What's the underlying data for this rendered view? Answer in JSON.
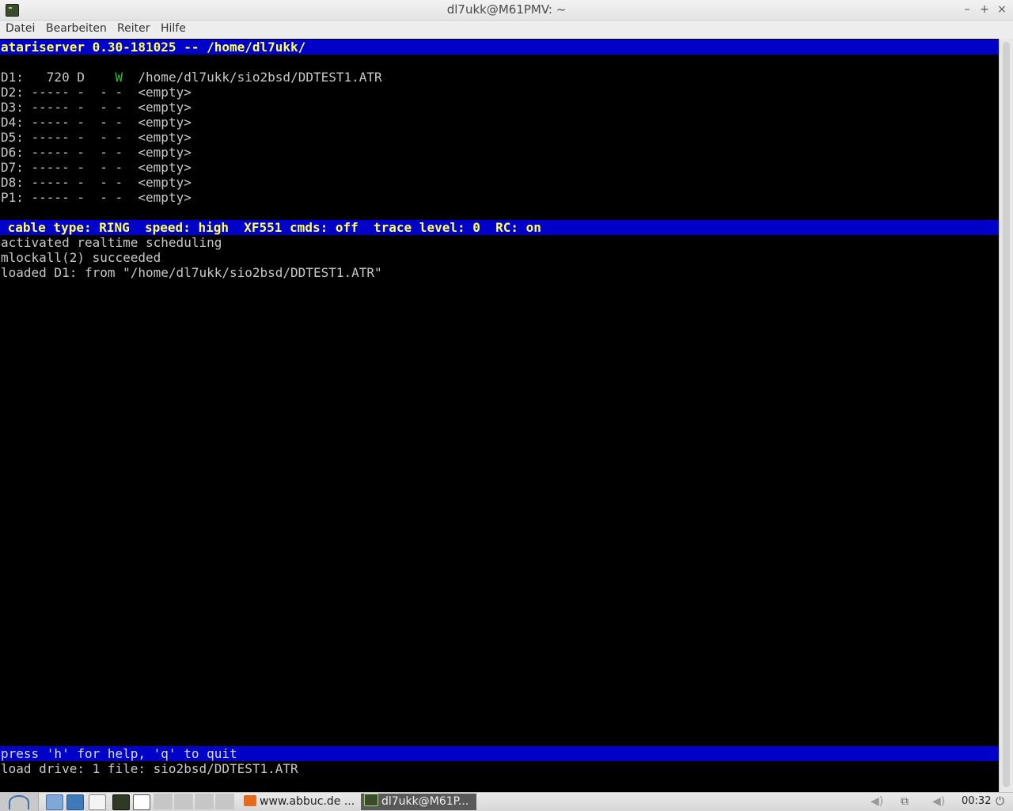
{
  "window": {
    "title": "dl7ukk@M61PMV: ~",
    "minimize": "–",
    "maximize": "+",
    "close": "×"
  },
  "menu": [
    "Datei",
    "Bearbeiten",
    "Reiter",
    "Hilfe"
  ],
  "terminal": {
    "header": "atariserver 0.30-181025 -- /home/dl7ukk/",
    "drives": [
      {
        "id": "D1:",
        "sectors": "720",
        "density": "D",
        "flag1": " ",
        "flag2": "W",
        "path": "/home/dl7ukk/sio2bsd/DDTEST1.ATR"
      },
      {
        "id": "D2:",
        "sectors": "-----",
        "density": "-",
        "flag1": "-",
        "flag2": "-",
        "path": "<empty>"
      },
      {
        "id": "D3:",
        "sectors": "-----",
        "density": "-",
        "flag1": "-",
        "flag2": "-",
        "path": "<empty>"
      },
      {
        "id": "D4:",
        "sectors": "-----",
        "density": "-",
        "flag1": "-",
        "flag2": "-",
        "path": "<empty>"
      },
      {
        "id": "D5:",
        "sectors": "-----",
        "density": "-",
        "flag1": "-",
        "flag2": "-",
        "path": "<empty>"
      },
      {
        "id": "D6:",
        "sectors": "-----",
        "density": "-",
        "flag1": "-",
        "flag2": "-",
        "path": "<empty>"
      },
      {
        "id": "D7:",
        "sectors": "-----",
        "density": "-",
        "flag1": "-",
        "flag2": "-",
        "path": "<empty>"
      },
      {
        "id": "D8:",
        "sectors": "-----",
        "density": "-",
        "flag1": "-",
        "flag2": "-",
        "path": "<empty>"
      },
      {
        "id": "P1:",
        "sectors": "-----",
        "density": "-",
        "flag1": "-",
        "flag2": "-",
        "path": "<empty>"
      }
    ],
    "status_bar": " cable type: RING  speed: high  XF551 cmds: off  trace level: 0  RC: on",
    "log": [
      "activated realtime scheduling",
      "mlockall(2) succeeded",
      "loaded D1: from \"/home/dl7ukk/sio2bsd/DDTEST1.ATR\""
    ],
    "help_bar": "press 'h' for help, 'q' to quit",
    "command_line": "load drive: 1 file: sio2bsd/DDTEST1.ATR"
  },
  "taskbar": {
    "tasks": [
      {
        "label": "www.abbuc.de ..."
      },
      {
        "label": "dl7ukk@M61P..."
      }
    ],
    "clock": "00:32"
  },
  "colors": {
    "terminal_bg": "#000000",
    "bar_bg": "#0000c8",
    "bar_fg": "#ffff55",
    "write_flag": "#23c823"
  }
}
